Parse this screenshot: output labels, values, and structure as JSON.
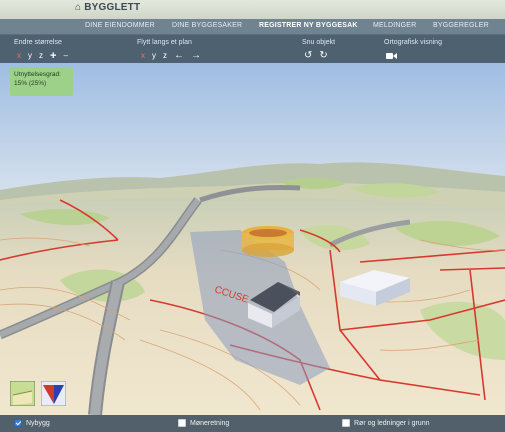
{
  "app": {
    "logo": "BYGGLETT"
  },
  "nav": [
    {
      "label": "DINE EIENDOMMER"
    },
    {
      "label": "DINE BYGGESAKER"
    },
    {
      "label": "REGISTRER NY BYGGESAK",
      "active": true
    },
    {
      "label": "MELDINGER"
    },
    {
      "label": "BYGGEREGLER"
    }
  ],
  "toolbar": {
    "resize": {
      "label": "Endre størrelse",
      "x": "x",
      "y": "y",
      "z": "z",
      "plus": "+",
      "minus": "–"
    },
    "move": {
      "label": "Flytt langs et plan",
      "x": "x",
      "y": "y",
      "z": "z",
      "left": "←",
      "right": "→"
    },
    "rotate": {
      "label": "Snu objekt",
      "ccw": "↺",
      "cw": "↻"
    },
    "ortho": {
      "label": "Ortografisk visning",
      "icon": "camera-icon"
    }
  },
  "utilization": {
    "label": "Utnyttelsesgrad:",
    "value": "15% (25%)"
  },
  "footer": {
    "nybygg": {
      "label": "Nybygg",
      "checked": true
    },
    "moneretning": {
      "label": "Møneretning",
      "checked": false
    },
    "ror": {
      "label": "Rør og ledninger i grunn",
      "checked": false
    }
  },
  "colors": {
    "accent_x": "#ff6b5c",
    "badge": "#9dd18a",
    "toolbar": "#4d6170",
    "nav": "#6f8390"
  }
}
